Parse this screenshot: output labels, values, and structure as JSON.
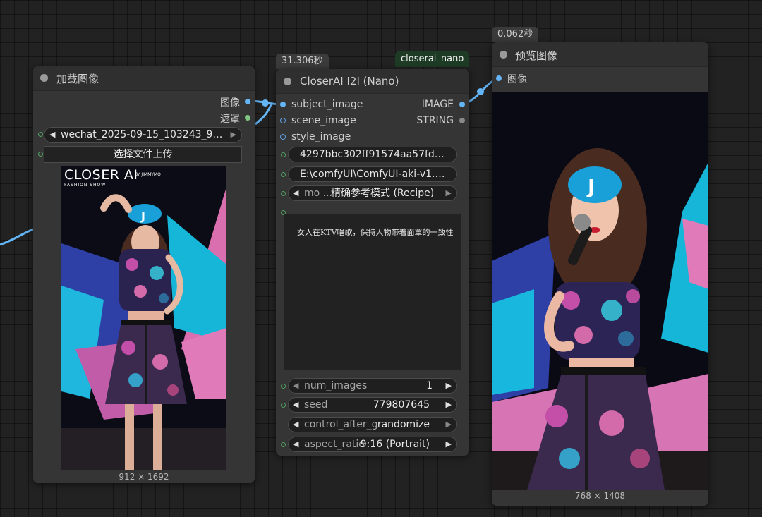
{
  "load_node": {
    "title": "加载图像",
    "outputs": [
      "图像",
      "遮罩"
    ],
    "file_widget": "wechat_2025-09-15_103243_925...",
    "upload_button": "选择文件上传",
    "image_dims": "912 × 1692",
    "image_brand": "CLOSER AI",
    "image_byline": "BY JIMMYMO",
    "image_subtitle": "FASHION SHOW"
  },
  "nano_node": {
    "time_badge": "31.306秒",
    "tag_badge": "closerai_nano",
    "title": "CloserAI I2I (Nano)",
    "inputs": [
      "subject_image",
      "scene_image",
      "style_image"
    ],
    "outputs": [
      "IMAGE",
      "STRING"
    ],
    "api_key": "4297bbc302ff91574aa57fd32ca...",
    "path": "E:\\comfyUI\\ComfyUI-aki-v1.4\\C ...",
    "mode": {
      "label": "mo ...",
      "value": "精确参考模式 (Recipe)"
    },
    "prompt_text": "女人在KTV唱歌，保持人物带着面罩的一致性",
    "num_images": {
      "label": "num_images",
      "value": "1"
    },
    "seed": {
      "label": "seed",
      "value": "779807645"
    },
    "control_after": {
      "label": "control_after_g ...",
      "value": "randomize"
    },
    "aspect_ratio": {
      "label": "aspect_ratio",
      "value": "9:16 (Portrait)"
    }
  },
  "preview_node": {
    "time_badge": "0.062秒",
    "title": "预览图像",
    "input": "图像",
    "image_dims": "768 × 1408"
  },
  "colors": {
    "image_link": "#64b5f6",
    "mask_link": "#81c784",
    "string_link": "#888888"
  },
  "icons": {
    "arrow_left": "◀",
    "arrow_right": "▶"
  }
}
